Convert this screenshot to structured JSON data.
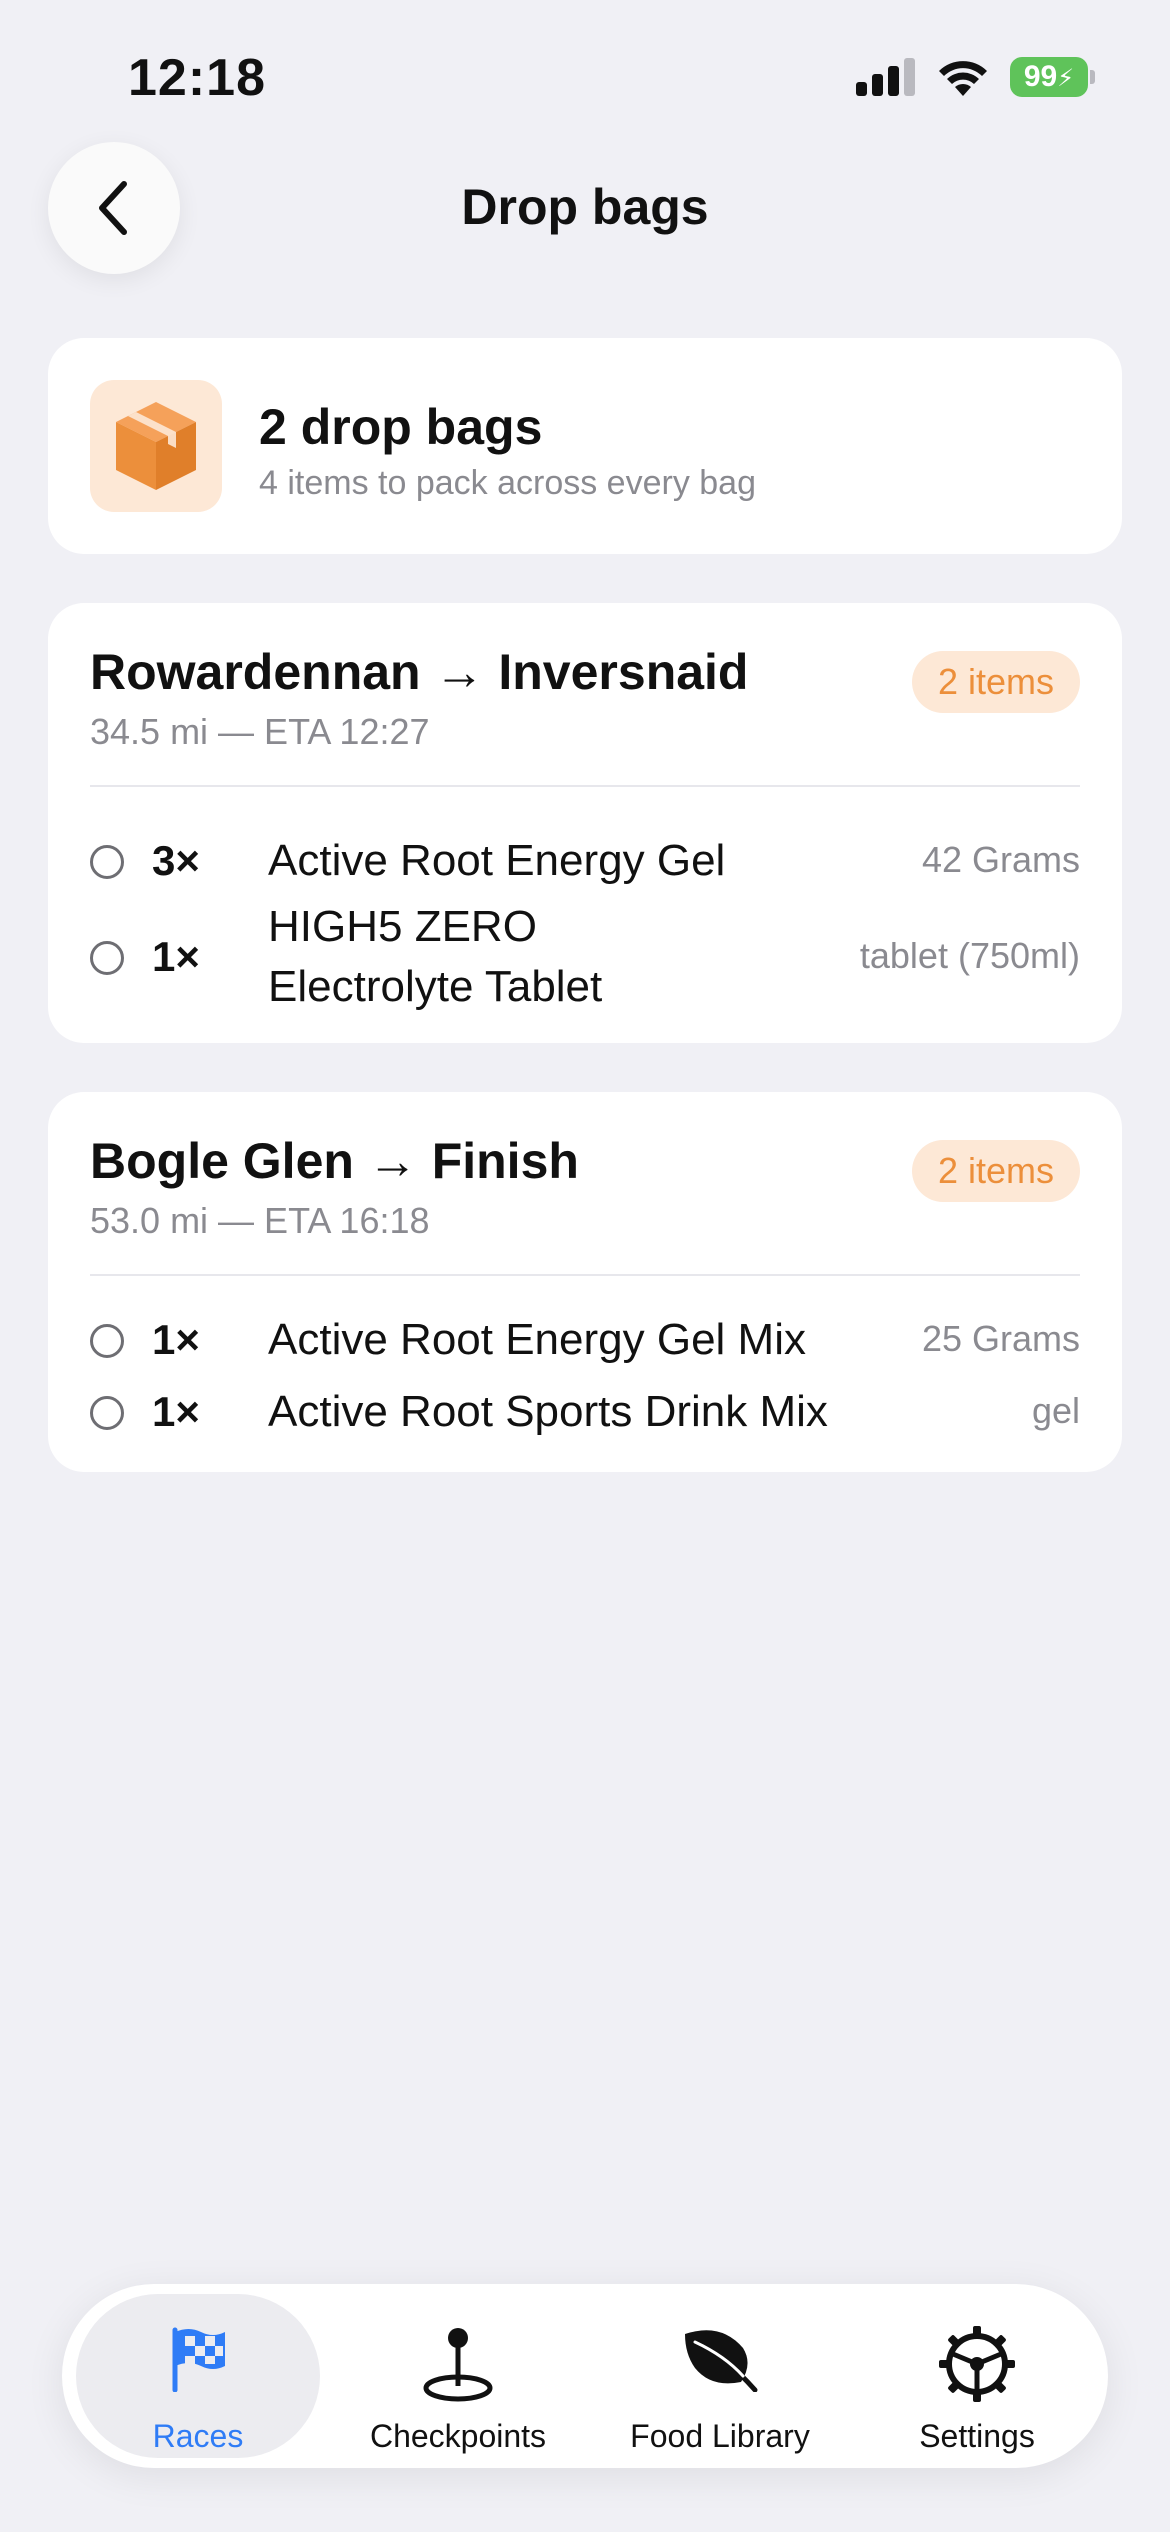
{
  "status_bar": {
    "time": "12:18",
    "battery": "99"
  },
  "header": {
    "title": "Drop bags"
  },
  "summary": {
    "title": "2 drop bags",
    "subtitle": "4 items to pack across every bag",
    "icon": "package-icon"
  },
  "bags": [
    {
      "title": "Rowardennan → Inversnaid",
      "subtitle": "34.5 mi — ETA 12:27",
      "badge": "2 items",
      "items": [
        {
          "qty": "3×",
          "name": "Active Root Energy Gel",
          "unit": "42 Grams"
        },
        {
          "qty": "1×",
          "name_line1": "HIGH5 ZERO",
          "name_line2": "Electrolyte Tablet",
          "unit": "tablet (750ml)"
        }
      ]
    },
    {
      "title": "Bogle Glen → Finish",
      "subtitle": "53.0 mi — ETA 16:18",
      "badge": "2 items",
      "items": [
        {
          "qty": "1×",
          "name": "Active Root Energy Gel Mix",
          "unit": "25 Grams"
        },
        {
          "qty": "1×",
          "name": "Active Root Sports Drink Mix",
          "unit": "gel"
        }
      ]
    }
  ],
  "tabs": [
    {
      "label": "Races",
      "icon": "checkered-flag-icon",
      "active": true
    },
    {
      "label": "Checkpoints",
      "icon": "map-pin-icon",
      "active": false
    },
    {
      "label": "Food Library",
      "icon": "leaf-icon",
      "active": false
    },
    {
      "label": "Settings",
      "icon": "steering-wheel-icon",
      "active": false
    }
  ],
  "colors": {
    "accent": "#2f7cf6",
    "orange": "#ec8f3b",
    "orange_bg": "#fde8d6",
    "battery": "#5fc35a",
    "background": "#f0f0f5"
  }
}
